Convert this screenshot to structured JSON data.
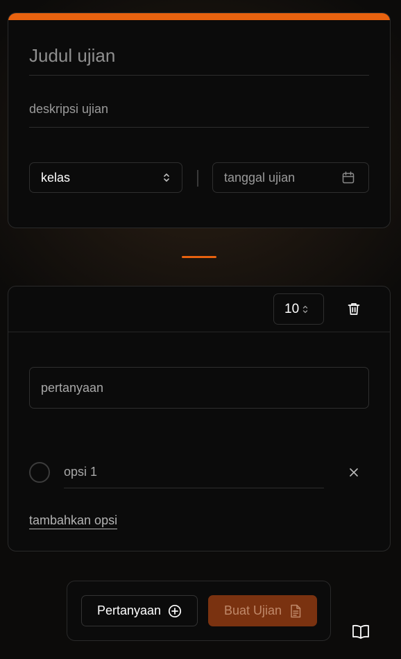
{
  "exam": {
    "title_placeholder": "Judul ujian",
    "description_placeholder": "deskripsi ujian",
    "class_select": {
      "value": "kelas"
    },
    "date_placeholder": "tanggal ujian"
  },
  "question": {
    "points": "10",
    "question_placeholder": "pertanyaan",
    "options": [
      {
        "placeholder": "opsi 1"
      }
    ],
    "add_option_label": "tambahkan opsi"
  },
  "toolbar": {
    "add_question_label": "Pertanyaan",
    "create_exam_label": "Buat Ujian"
  },
  "icons": {
    "class_chevron": "chevron-up-down-icon",
    "date": "calendar-icon",
    "points_chevron": "chevron-up-down-icon",
    "delete": "trash-icon",
    "remove_option": "close-icon",
    "add_question": "plus-circle-icon",
    "create_exam": "document-icon",
    "docs": "book-open-icon"
  },
  "colors": {
    "accent": "#e8620f",
    "create_button_bg": "#7a3210",
    "create_button_text": "#c0896a",
    "background": "#0c0b0a"
  }
}
